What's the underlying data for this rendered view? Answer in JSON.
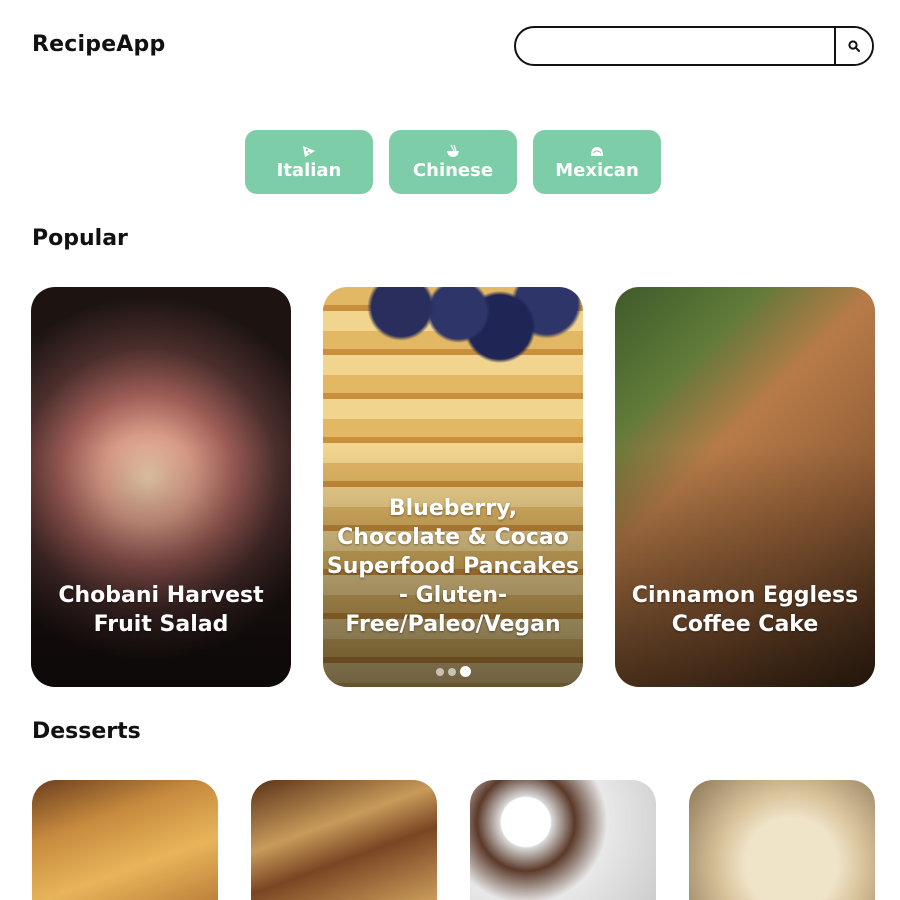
{
  "header": {
    "logo": "RecipeApp",
    "search_placeholder": "",
    "search_icon": "search-icon"
  },
  "categories": [
    {
      "label": "Italian",
      "icon": "pizza-icon"
    },
    {
      "label": "Chinese",
      "icon": "noodle-bowl-icon"
    },
    {
      "label": "Mexican",
      "icon": "taco-icon"
    }
  ],
  "sections": {
    "popular": "Popular",
    "desserts": "Desserts"
  },
  "popular_cards": [
    {
      "title": "Chobani Harvest Fruit Salad"
    },
    {
      "title": "Blueberry, Chocolate & Cocao Superfood Pancakes - Gluten-Free/Paleo/Vegan"
    },
    {
      "title": "Cinnamon Eggless Coffee Cake"
    }
  ],
  "carousel": {
    "dot_count": 3,
    "active_index": 2
  },
  "colors": {
    "category_bg": "#7dcea8",
    "text": "#111111"
  }
}
